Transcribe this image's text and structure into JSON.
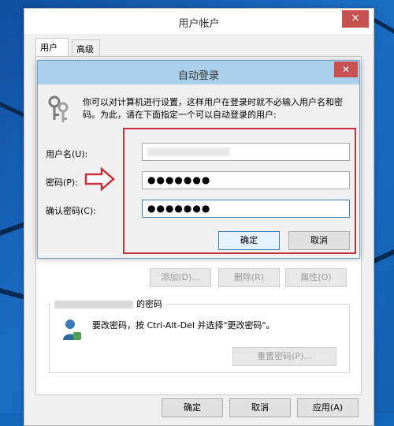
{
  "outer_window": {
    "title": "用户帐户",
    "close_glyph": "✕",
    "tabs": [
      {
        "label": "用户"
      },
      {
        "label": "高级"
      }
    ],
    "buttons": {
      "add": "添加(D)...",
      "remove": "删除(R)",
      "properties": "属性(O)",
      "reset_password": "重置密码(P)...",
      "ok": "确定",
      "cancel": "取消",
      "apply": "应用(A)"
    },
    "password_group": {
      "title_suffix": "的密码",
      "text": "要改密码，按 Ctrl-Alt-Del 并选择\"更改密码\"。"
    }
  },
  "dialog": {
    "title": "自动登录",
    "close_glyph": "✕",
    "description": "你可以对计算机进行设置，这样用户在登录时就不必输入用户名和密码。为此，请在下面指定一个可以自动登录的用户:",
    "fields": {
      "username_label": "用户名(U):",
      "password_label": "密码(P):",
      "confirm_label": "确认密码(C):",
      "password_value": "●●●●●●●",
      "confirm_value": "●●●●●●●"
    },
    "buttons": {
      "ok": "确定",
      "cancel": "取消"
    }
  },
  "colors": {
    "highlight_red": "#c8313b",
    "dialog_titlebar": "#a9cfe9",
    "close_red": "#c75050"
  }
}
